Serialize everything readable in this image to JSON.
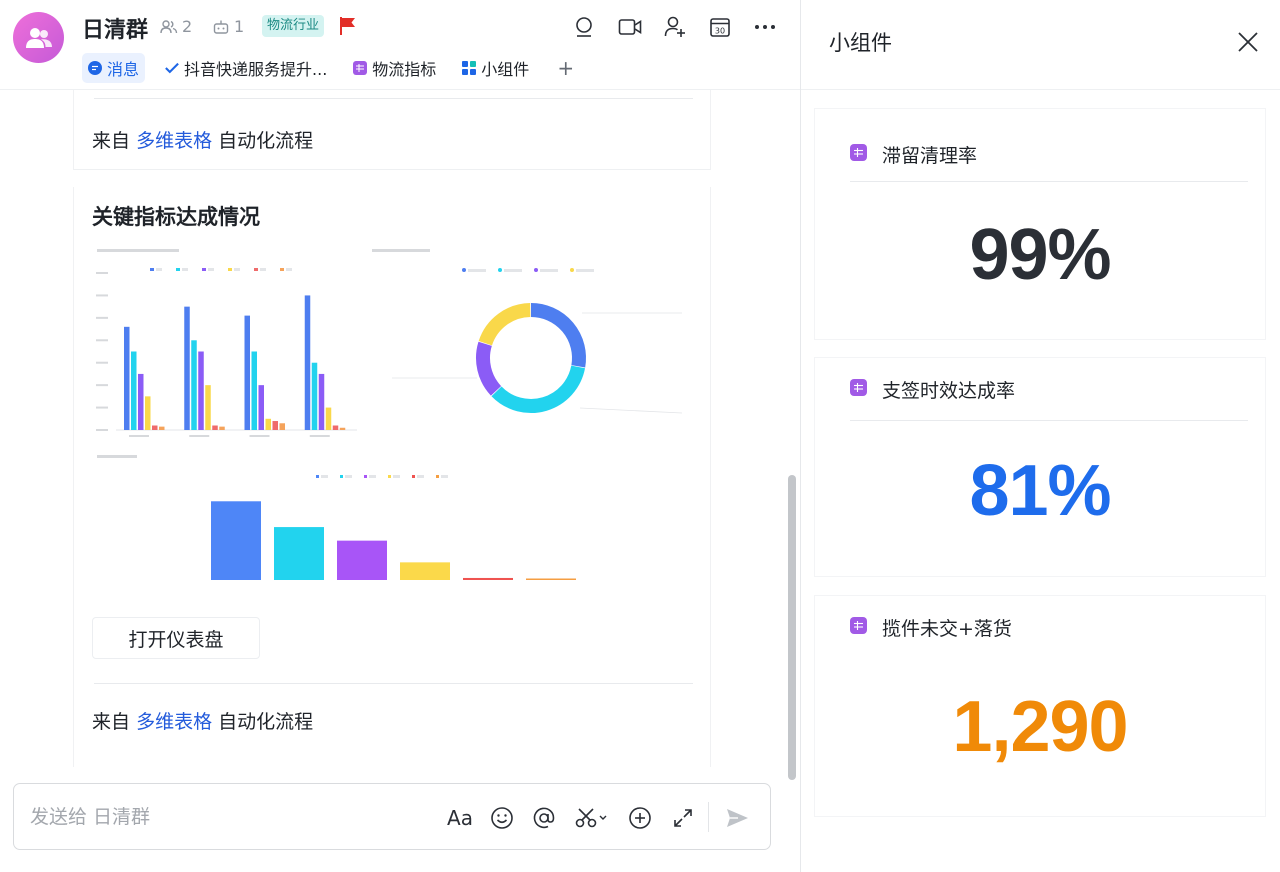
{
  "header": {
    "group_name": "日清群",
    "member_count": "2",
    "bot_count": "1",
    "tag": "物流行业",
    "tabs": [
      {
        "label": "消息",
        "icon": "chat-bubble-icon"
      },
      {
        "label": "抖音快递服务提升...",
        "icon": "check-doc-icon"
      },
      {
        "label": "物流指标",
        "icon": "sheet-icon"
      },
      {
        "label": "小组件",
        "icon": "widget-grid-icon"
      }
    ],
    "add_tab": "+",
    "icons": [
      "search-icon",
      "video-call-icon",
      "add-member-icon",
      "calendar-icon",
      "more-icon"
    ],
    "calendar_day": "30"
  },
  "messages": {
    "first": {
      "prefix": "来自",
      "source": "多维表格",
      "suffix": "自动化流程"
    },
    "dashboard_card": {
      "title": "关键指标达成情况",
      "open_button": "打开仪表盘",
      "prefix": "来自",
      "source": "多维表格",
      "suffix": "自动化流程"
    }
  },
  "chart_data": [
    {
      "type": "bar",
      "categories": [
        "",
        "",
        "",
        ""
      ],
      "series": [
        {
          "name": "",
          "color": "#4e7ef0",
          "values": [
            920,
            1100,
            1020,
            1200
          ]
        },
        {
          "name": "",
          "color": "#22d3ee",
          "values": [
            700,
            800,
            700,
            600
          ]
        },
        {
          "name": "",
          "color": "#8b5cf6",
          "values": [
            500,
            700,
            400,
            500
          ]
        },
        {
          "name": "",
          "color": "#f9d84a",
          "values": [
            300,
            400,
            100,
            200
          ]
        },
        {
          "name": "",
          "color": "#ef6b6b",
          "values": [
            40,
            40,
            80,
            40
          ]
        },
        {
          "name": "",
          "color": "#f5a35b",
          "values": [
            30,
            30,
            60,
            20
          ]
        }
      ],
      "ylim": [
        0,
        1400
      ],
      "yticks": [
        0,
        200,
        400,
        600,
        800,
        1000,
        1200,
        1400
      ]
    },
    {
      "type": "pie",
      "donut": true,
      "slices": [
        {
          "value": 28,
          "color": "#4e7ef0"
        },
        {
          "value": 35,
          "color": "#22d3ee"
        },
        {
          "value": 17,
          "color": "#8b5cf6"
        },
        {
          "value": 20,
          "color": "#f9d84a"
        }
      ]
    },
    {
      "type": "bar",
      "categories": [
        "",
        "",
        "",
        "",
        "",
        ""
      ],
      "values": [
        1160,
        780,
        580,
        260,
        30,
        15
      ],
      "colors": [
        "#4e86f7",
        "#22d3ee",
        "#a855f7",
        "#fbd94a",
        "#ef5350",
        "#f59e42"
      ],
      "ylim": [
        0,
        1400
      ]
    }
  ],
  "composer": {
    "placeholder": "发送给 日清群",
    "font_label": "Aa",
    "icons": [
      "font-style-icon",
      "emoji-icon",
      "mention-icon",
      "scissors-icon",
      "add-icon",
      "expand-icon",
      "send-icon"
    ]
  },
  "widgets_panel": {
    "title": "小组件",
    "items": [
      {
        "label": "滞留清理率",
        "value": "99%",
        "color": "#2b2f36"
      },
      {
        "label": "支签时效达成率",
        "value": "81%",
        "color": "#1e6cec"
      },
      {
        "label": "揽件未交+落货",
        "value": "1,290",
        "color": "#f08a08"
      }
    ]
  }
}
